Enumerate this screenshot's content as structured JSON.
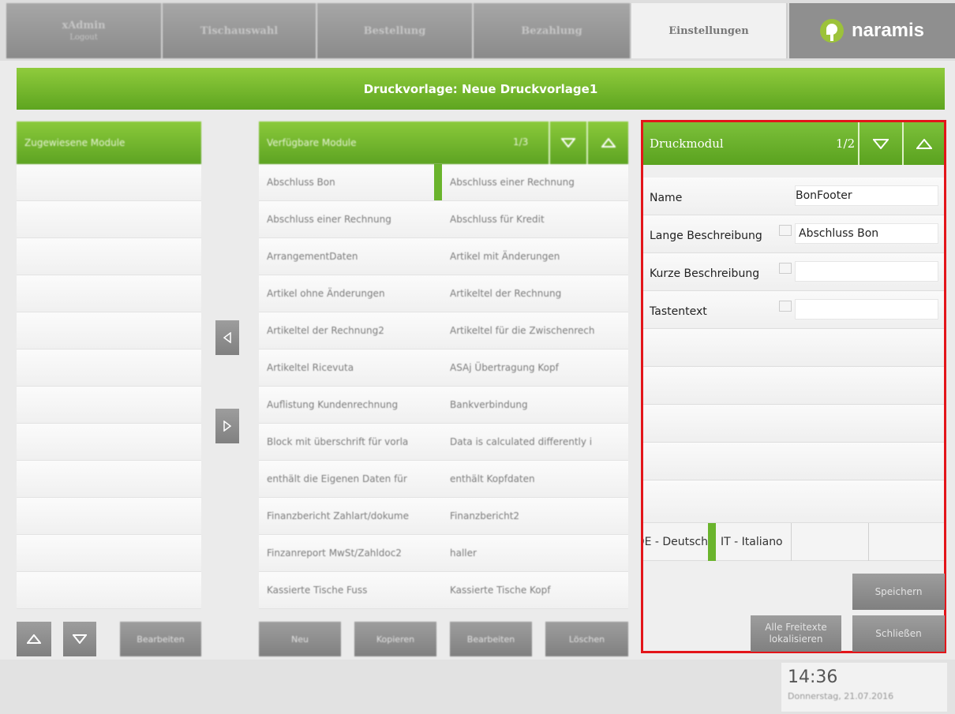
{
  "nav": {
    "tabs": [
      {
        "label": "xAdmin",
        "sub": "Logout"
      },
      {
        "label": "Tischauswahl",
        "sub": ""
      },
      {
        "label": "Bestellung",
        "sub": ""
      },
      {
        "label": "Bezahlung",
        "sub": ""
      },
      {
        "label": "Einstellungen",
        "sub": ""
      }
    ],
    "logo_text": "naramis"
  },
  "page": {
    "title": "Druckvorlage:  Neue Druckvorlage1"
  },
  "assigned": {
    "title": "Zugewiesene Module",
    "edit_label": "Bearbeiten"
  },
  "available": {
    "title": "Verfügbare Module",
    "page": "1/3",
    "rows": [
      [
        "Abschluss Bon",
        "Abschluss einer Rechnung"
      ],
      [
        "Abschluss einer Rechnung",
        "Abschluss für Kredit"
      ],
      [
        "ArrangementDaten",
        "Artikel mit Änderungen"
      ],
      [
        "Artikel ohne Änderungen",
        "Artikeltel der Rechnung"
      ],
      [
        "Artikeltel der Rechnung2",
        "Artikeltel für die Zwischenrech"
      ],
      [
        "Artikeltel Ricevuta",
        "ASAj Übertragung Kopf"
      ],
      [
        "Auflistung Kundenrechnung",
        "Bankverbindung"
      ],
      [
        "Block mit überschrift für vorla",
        "Data is calculated differently i"
      ],
      [
        "enthält die Eigenen Daten für",
        "enthält Kopfdaten"
      ],
      [
        "Finanzbericht Zahlart/dokume",
        "Finanzbericht2"
      ],
      [
        "Finzanreport MwSt/Zahldoc2",
        "haller"
      ],
      [
        "Kassierte Tische Fuss",
        "Kassierte Tische Kopf"
      ]
    ],
    "buttons": [
      "Neu",
      "Kopieren",
      "Bearbeiten",
      "Löschen"
    ]
  },
  "module": {
    "title": "Druckmodul",
    "page": "1/2",
    "fields": [
      {
        "label": "Name",
        "value": "BonFooter"
      },
      {
        "label": "Lange Beschreibung",
        "value": "Abschluss Bon"
      },
      {
        "label": "Kurze Beschreibung",
        "value": ""
      },
      {
        "label": "Tastentext",
        "value": ""
      }
    ],
    "languages": [
      "DE - Deutsch",
      "IT - Italiano"
    ],
    "save_label": "Speichern",
    "localize_label_1": "Alle Freitexte",
    "localize_label_2": "lokalisieren",
    "close_label": "Schließen"
  },
  "clock": {
    "time": "14:36",
    "date": "Donnerstag, 21.07.2016"
  },
  "colors": {
    "green": "#6ab42c",
    "highlight": "#e3151a"
  }
}
